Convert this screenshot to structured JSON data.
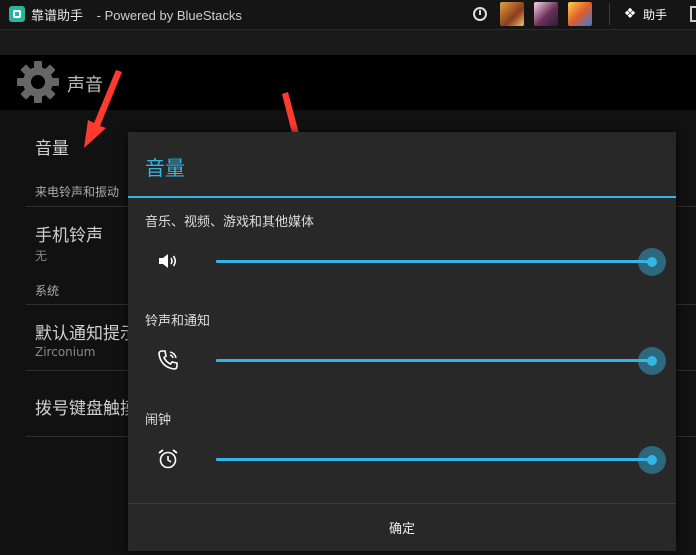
{
  "window": {
    "title": "靠谱助手",
    "subtitle": "- Powered by BlueStacks",
    "helper_label": "助手"
  },
  "header": {
    "title": "声音"
  },
  "settings": {
    "volume": "音量",
    "category_ringtone": "来电铃声和振动",
    "ringtone_title": "手机铃声",
    "ringtone_value": "无",
    "category_system": "系统",
    "notification_title": "默认通知提示",
    "notification_value": "Zirconium",
    "dialpad_title": "拨号键盘触摸"
  },
  "dialog": {
    "title": "音量",
    "sliders": [
      {
        "label": "音乐、视频、游戏和其他媒体",
        "icon": "speaker-icon",
        "value": 1.0
      },
      {
        "label": "铃声和通知",
        "icon": "phone-ring-icon",
        "value": 1.0
      },
      {
        "label": "闹钟",
        "icon": "alarm-clock-icon",
        "value": 1.0
      }
    ],
    "ok_label": "确定"
  },
  "colors": {
    "accent": "#33b5e5",
    "annotation_arrow": "#ff3b2f"
  }
}
